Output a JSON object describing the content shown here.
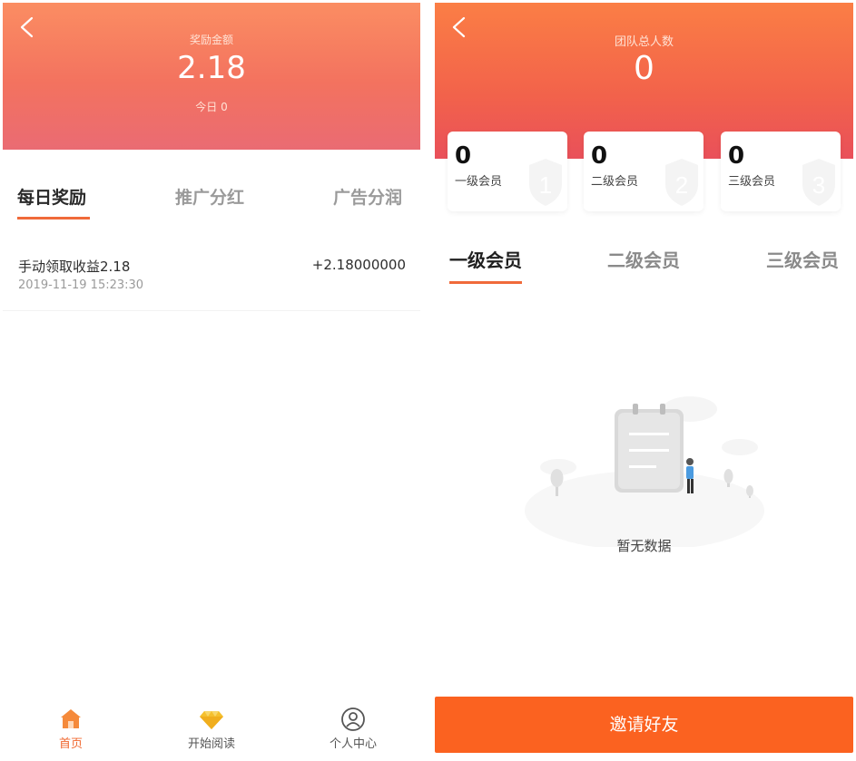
{
  "left": {
    "header": {
      "label": "奖励金额",
      "amount": "2.18",
      "today": "今日 0"
    },
    "tabs": [
      {
        "label": "每日奖励",
        "active": true
      },
      {
        "label": "推广分红",
        "active": false
      },
      {
        "label": "广告分润",
        "active": false
      }
    ],
    "records": [
      {
        "title": "手动领取收益2.18",
        "time": "2019-11-19 15:23:30",
        "value": "+2.18000000"
      }
    ],
    "bottom_nav": [
      {
        "label": "首页",
        "icon": "home-icon",
        "active": true
      },
      {
        "label": "开始阅读",
        "icon": "diamond-icon",
        "active": false
      },
      {
        "label": "个人中心",
        "icon": "user-icon",
        "active": false
      }
    ]
  },
  "right": {
    "header": {
      "label": "团队总人数",
      "count": "0"
    },
    "cards": [
      {
        "num": "0",
        "label": "一级会员",
        "badge": "1"
      },
      {
        "num": "0",
        "label": "二级会员",
        "badge": "2"
      },
      {
        "num": "0",
        "label": "三级会员",
        "badge": "3"
      }
    ],
    "tabs": [
      {
        "label": "一级会员",
        "active": true
      },
      {
        "label": "二级会员",
        "active": false
      },
      {
        "label": "三级会员",
        "active": false
      }
    ],
    "empty_text": "暂无数据",
    "invite_label": "邀请好友"
  },
  "colors": {
    "accent": "#f06a3a",
    "invite_bg": "#fb6220",
    "left_header_top": "#fb8d62",
    "right_header_top": "#fb7e45"
  }
}
